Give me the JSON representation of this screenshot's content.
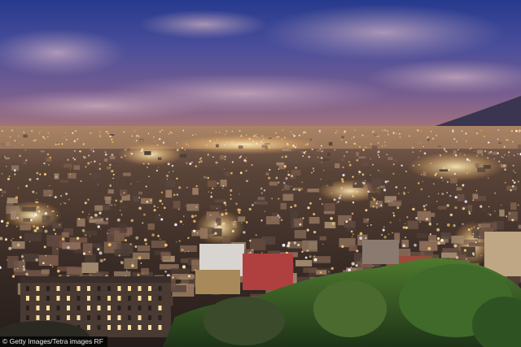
{
  "photo": {
    "credit": "© Getty Images/Tetra images RF",
    "palette": {
      "sky_top": "#2b3d8c",
      "sky_mid": "#6e5f94",
      "horizon_glow": "#c98a6a",
      "city_dark": "#2a2220",
      "city_light": "#ffd27a",
      "foliage": "#2f5a2a"
    }
  }
}
